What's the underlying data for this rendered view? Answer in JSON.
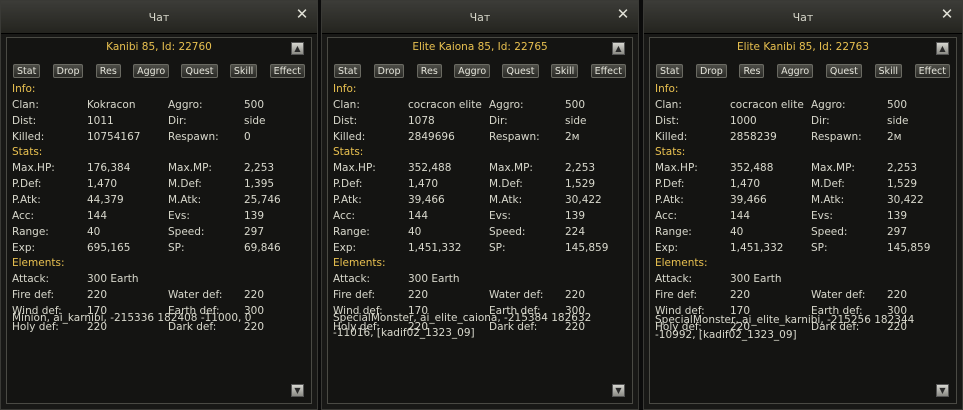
{
  "common": {
    "tabs": [
      "Stat",
      "Drop",
      "Res",
      "Aggro",
      "Quest",
      "Skill",
      "Effect"
    ],
    "labels": {
      "info": "Info:",
      "clan": "Clan:",
      "aggro": "Aggro:",
      "dist": "Dist:",
      "dir": "Dir:",
      "killed": "Killed:",
      "respawn": "Respawn:",
      "stats": "Stats:",
      "maxhp": "Max.HP:",
      "maxmp": "Max.MP:",
      "pdef": "P.Def:",
      "mdef": "M.Def:",
      "patk": "P.Atk:",
      "matk": "M.Atk:",
      "acc": "Acc:",
      "evs": "Evs:",
      "range": "Range:",
      "speed": "Speed:",
      "exp": "Exp:",
      "sp": "SP:",
      "elements": "Elements:",
      "attack": "Attack:",
      "fire": "Fire def:",
      "water": "Water def:",
      "wind": "Wind def:",
      "earth": "Earth def:",
      "holy": "Holy def:",
      "dark": "Dark def:"
    }
  },
  "windows": [
    {
      "title": "Чат",
      "mob_title": "Kanibi 85, Id: 22760",
      "clan": "Kokracon",
      "aggro": "500",
      "dist": "1011",
      "dir": "side",
      "killed": "10754167",
      "respawn": "0",
      "maxhp": "176,384",
      "maxmp": "2,253",
      "pdef": "1,470",
      "mdef": "1,395",
      "patk": "44,379",
      "matk": "25,746",
      "acc": "144",
      "evs": "139",
      "range": "40",
      "speed": "297",
      "exp": "695,165",
      "sp": "69,846",
      "attack": "300 Earth",
      "fire": "220",
      "water": "220",
      "wind": "170",
      "earth": "300",
      "holy": "220",
      "dark": "220",
      "footer": [
        "Minion, ai_karnibi, -215336 182408 -11000, 0"
      ]
    },
    {
      "title": "Чат",
      "mob_title": "Elite Kaiona 85, Id: 22765",
      "clan": "cocracon elite",
      "aggro": "500",
      "dist": "1078",
      "dir": "side",
      "killed": "2849696",
      "respawn": "2м",
      "maxhp": "352,488",
      "maxmp": "2,253",
      "pdef": "1,470",
      "mdef": "1,529",
      "patk": "39,466",
      "matk": "30,422",
      "acc": "144",
      "evs": "139",
      "range": "40",
      "speed": "224",
      "exp": "1,451,332",
      "sp": "145,859",
      "attack": "300 Earth",
      "fire": "220",
      "water": "220",
      "wind": "170",
      "earth": "300",
      "holy": "220",
      "dark": "220",
      "footer": [
        "SpecialMonster, ai_elite_caiona, -215384 182632",
        "-11016, [kadif02_1323_09]"
      ]
    },
    {
      "title": "Чат",
      "mob_title": "Elite Kanibi 85, Id: 22763",
      "clan": "cocracon elite",
      "aggro": "500",
      "dist": "1000",
      "dir": "side",
      "killed": "2858239",
      "respawn": "2м",
      "maxhp": "352,488",
      "maxmp": "2,253",
      "pdef": "1,470",
      "mdef": "1,529",
      "patk": "39,466",
      "matk": "30,422",
      "acc": "144",
      "evs": "139",
      "range": "40",
      "speed": "297",
      "exp": "1,451,332",
      "sp": "145,859",
      "attack": "300 Earth",
      "fire": "220",
      "water": "220",
      "wind": "170",
      "earth": "300",
      "holy": "220",
      "dark": "220",
      "footer": [
        "SpecialMonster, ai_elite_karnibi, -215256 182344",
        "-10992, [kadif02_1323_09]"
      ]
    }
  ]
}
